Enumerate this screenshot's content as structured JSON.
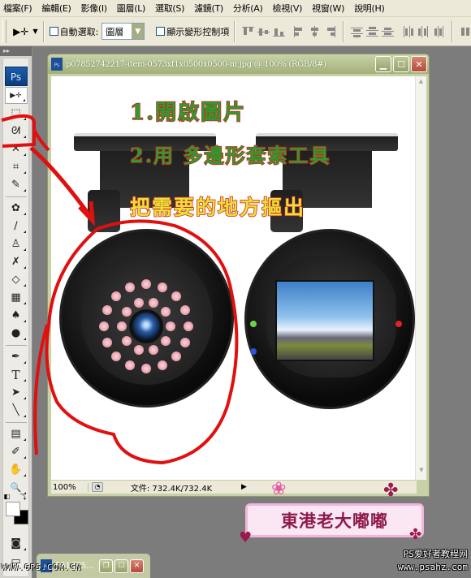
{
  "menubar": {
    "items": [
      "檔案(F)",
      "編輯(E)",
      "影像(I)",
      "圖層(L)",
      "選取(S)",
      "濾鏡(T)",
      "分析(A)",
      "檢視(V)",
      "視窗(W)",
      "說明(H)"
    ]
  },
  "options": {
    "auto_select_label": "自動選取:",
    "auto_select_checked": false,
    "auto_select_value": "圖層",
    "show_transform_label": "顯示變形控制項",
    "show_transform_checked": false
  },
  "toolbox": {
    "logo": "Ps",
    "tools": [
      {
        "name": "move-tool",
        "glyph": "▶✛"
      },
      {
        "name": "marquee-tool",
        "glyph": "⬚"
      },
      {
        "name": "lasso-tool",
        "glyph": "ᘛ"
      },
      {
        "name": "magic-wand-tool",
        "glyph": "✕"
      },
      {
        "name": "crop-tool",
        "glyph": "⌗"
      },
      {
        "name": "slice-tool",
        "glyph": "✎"
      },
      {
        "name": "healing-brush-tool",
        "glyph": "✿"
      },
      {
        "name": "brush-tool",
        "glyph": "∕"
      },
      {
        "name": "clone-stamp-tool",
        "glyph": "♙"
      },
      {
        "name": "history-brush-tool",
        "glyph": "✗"
      },
      {
        "name": "eraser-tool",
        "glyph": "◇"
      },
      {
        "name": "gradient-tool",
        "glyph": "▦"
      },
      {
        "name": "blur-tool",
        "glyph": "♠"
      },
      {
        "name": "dodge-tool",
        "glyph": "●"
      },
      {
        "name": "pen-tool",
        "glyph": "✒"
      },
      {
        "name": "type-tool",
        "glyph": "T"
      },
      {
        "name": "path-selection-tool",
        "glyph": "➤"
      },
      {
        "name": "line-tool",
        "glyph": "╲"
      },
      {
        "name": "notes-tool",
        "glyph": "▤"
      },
      {
        "name": "eyedropper-tool",
        "glyph": "✐"
      },
      {
        "name": "hand-tool",
        "glyph": "✋"
      },
      {
        "name": "zoom-tool",
        "glyph": "🔍"
      }
    ],
    "foreground_color": "#ffffff",
    "background_color": "#000000"
  },
  "document": {
    "title": "p07852742217-item-0573xf1x0500x0500-m.jpg @ 100% (RGB/8#)",
    "zoom": "100%",
    "file_info": "文件: 732.4K/732.4K",
    "instructions": [
      "1.開啟圖片",
      "2.用 多邊形套索工具",
      "把需要的地方摳出"
    ]
  },
  "minimized_document": {
    "title": "551375..."
  },
  "watermark": {
    "banner_text": "東港老大嘟嘟",
    "site_line1": "PS爱好者教程网",
    "site_line2": "www.psahz.com",
    "left_mark": "WWW.6PS.COM.CN"
  },
  "colors": {
    "annotation_red": "#e01010",
    "instruction_green": "#2f9a2e",
    "instruction_yellow": "#e7e13a",
    "window_frame": "#a4b07a"
  }
}
